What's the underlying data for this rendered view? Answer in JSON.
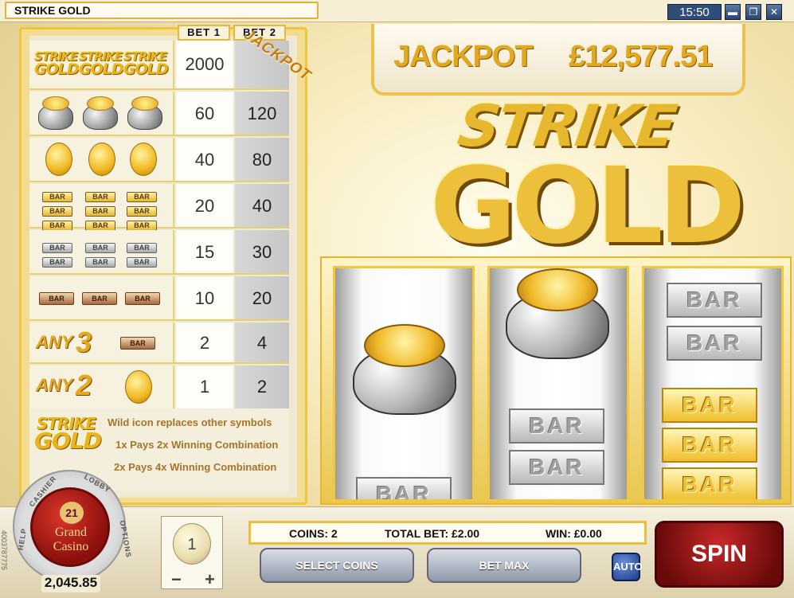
{
  "window": {
    "title": "STRIKE GOLD",
    "clock": "15:50",
    "controls": {
      "minimize": "▬",
      "restore": "❐",
      "close": "✕"
    }
  },
  "paytable": {
    "bet1_label": "BET 1",
    "bet2_label": "BET 2",
    "jackpot_tag": "JACKPOT",
    "rows": [
      {
        "symbol": "strike-gold-logo-x3",
        "bet1": "2000",
        "bet2": ""
      },
      {
        "symbol": "pot-of-gold-x3",
        "bet1": "60",
        "bet2": "120"
      },
      {
        "symbol": "gold-coin-x3",
        "bet1": "40",
        "bet2": "80"
      },
      {
        "symbol": "triple-gold-bar-x3",
        "bet1": "20",
        "bet2": "40"
      },
      {
        "symbol": "double-silver-bar-x3",
        "bet1": "15",
        "bet2": "30"
      },
      {
        "symbol": "single-bronze-bar-x3",
        "bet1": "10",
        "bet2": "20"
      },
      {
        "symbol": "any-3-bar",
        "any_word": "ANY",
        "any_num": "3",
        "bet1": "2",
        "bet2": "4"
      },
      {
        "symbol": "any-2-coin",
        "any_word": "ANY",
        "any_num": "2",
        "bet1": "1",
        "bet2": "2"
      }
    ],
    "bar_text": "BAR",
    "logo_line1": "STRIKE",
    "logo_line2": "GOLD",
    "wild": {
      "line1": "Wild icon replaces other symbols",
      "line2": "1x Pays 2x Winning Combination",
      "line3": "2x Pays 4x Winning Combination"
    }
  },
  "jackpot": {
    "label": "JACKPOT",
    "value": "£12,577.51"
  },
  "logo": {
    "line1": "STRIKE",
    "line2": "GOLD"
  },
  "reels": {
    "bar_text": "BAR"
  },
  "casino": {
    "name_line1": "Grand",
    "name_line2": "Casino",
    "emblem": "21",
    "cashier": "CASHIER",
    "lobby": "LOBBY",
    "help": "HELP",
    "options": "OPTIONS",
    "balance": "2,045.85",
    "side_id": "4003787775"
  },
  "coin_selector": {
    "value": "1",
    "minus": "−",
    "plus": "+"
  },
  "status": {
    "coins": "COINS: 2",
    "total_bet": "TOTAL BET: £2.00",
    "win": "WIN: £0.00"
  },
  "buttons": {
    "select_coins": "SELECT COINS",
    "bet_max": "BET MAX",
    "auto": "AUTO",
    "spin": "SPIN"
  },
  "colors": {
    "accent_gold": "#e8b420",
    "spin_red": "#c8282a",
    "button_blue_gray": "#8f98a8"
  }
}
